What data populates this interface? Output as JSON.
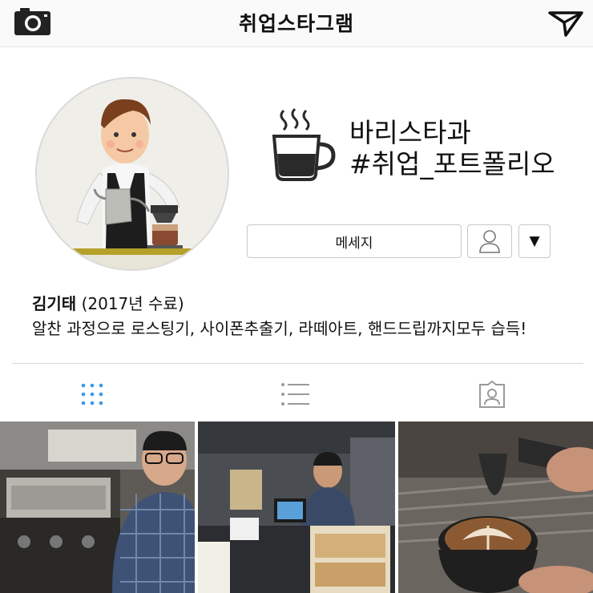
{
  "app": {
    "title": "취업스타그램"
  },
  "profile": {
    "line1": "바리스타과",
    "line2": "#취업_포트폴리오",
    "message_button": "메세지",
    "dropdown_glyph": "▼"
  },
  "bio": {
    "name": "김기태",
    "meta": "(2017년 수료)",
    "description": "알찬 과정으로 로스팅기, 사이폰추출기, 라떼아트, 핸드드립까지모두 습득!"
  },
  "tabs": {
    "active": "grid",
    "accent_color": "#3897f0",
    "inactive_color": "#9a9a9a"
  },
  "grid": {
    "photos": [
      "barista-at-espresso-machine",
      "barista-in-cafe",
      "latte-art-pour"
    ]
  }
}
